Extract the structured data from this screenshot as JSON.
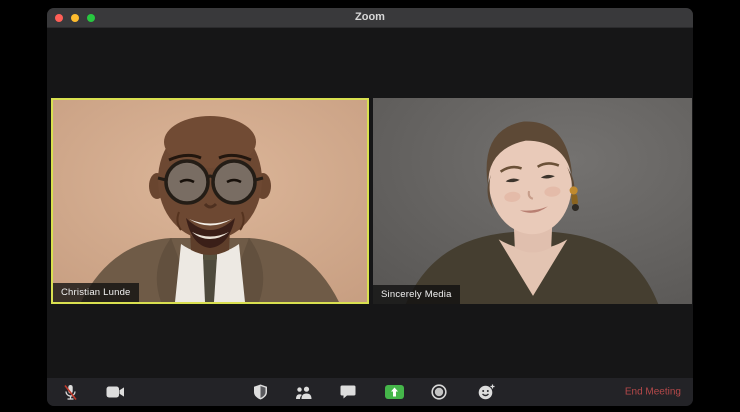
{
  "window": {
    "title": "Zoom",
    "traffic_lights": [
      {
        "name": "close",
        "color": "#ff5f57"
      },
      {
        "name": "minimize",
        "color": "#febc2e"
      },
      {
        "name": "zoom",
        "color": "#28c840"
      }
    ]
  },
  "participants": [
    {
      "name": "Christian Lunde",
      "active_speaker": true,
      "muted_indicator": false
    },
    {
      "name": "Sincerely Media",
      "active_speaker": false,
      "muted_indicator": false
    }
  ],
  "toolbar": {
    "items": [
      {
        "icon": "microphone-muted-icon",
        "action": "unmute"
      },
      {
        "icon": "video-camera-icon",
        "action": "stop-video"
      },
      {
        "icon": "security-shield-icon",
        "action": "security"
      },
      {
        "icon": "participants-icon",
        "action": "manage-participants"
      },
      {
        "icon": "chat-bubble-icon",
        "action": "chat"
      },
      {
        "icon": "share-screen-icon",
        "action": "share-screen"
      },
      {
        "icon": "record-icon",
        "action": "record"
      },
      {
        "icon": "reactions-icon",
        "action": "reactions"
      }
    ],
    "end_meeting_label": "End Meeting"
  },
  "colors": {
    "active_speaker_border": "#d9e050",
    "share_screen_green": "#45b64a",
    "end_meeting_red": "#b5494a",
    "titlebar": "#39393b",
    "toolbar": "#232327",
    "window_background": "#161617"
  }
}
